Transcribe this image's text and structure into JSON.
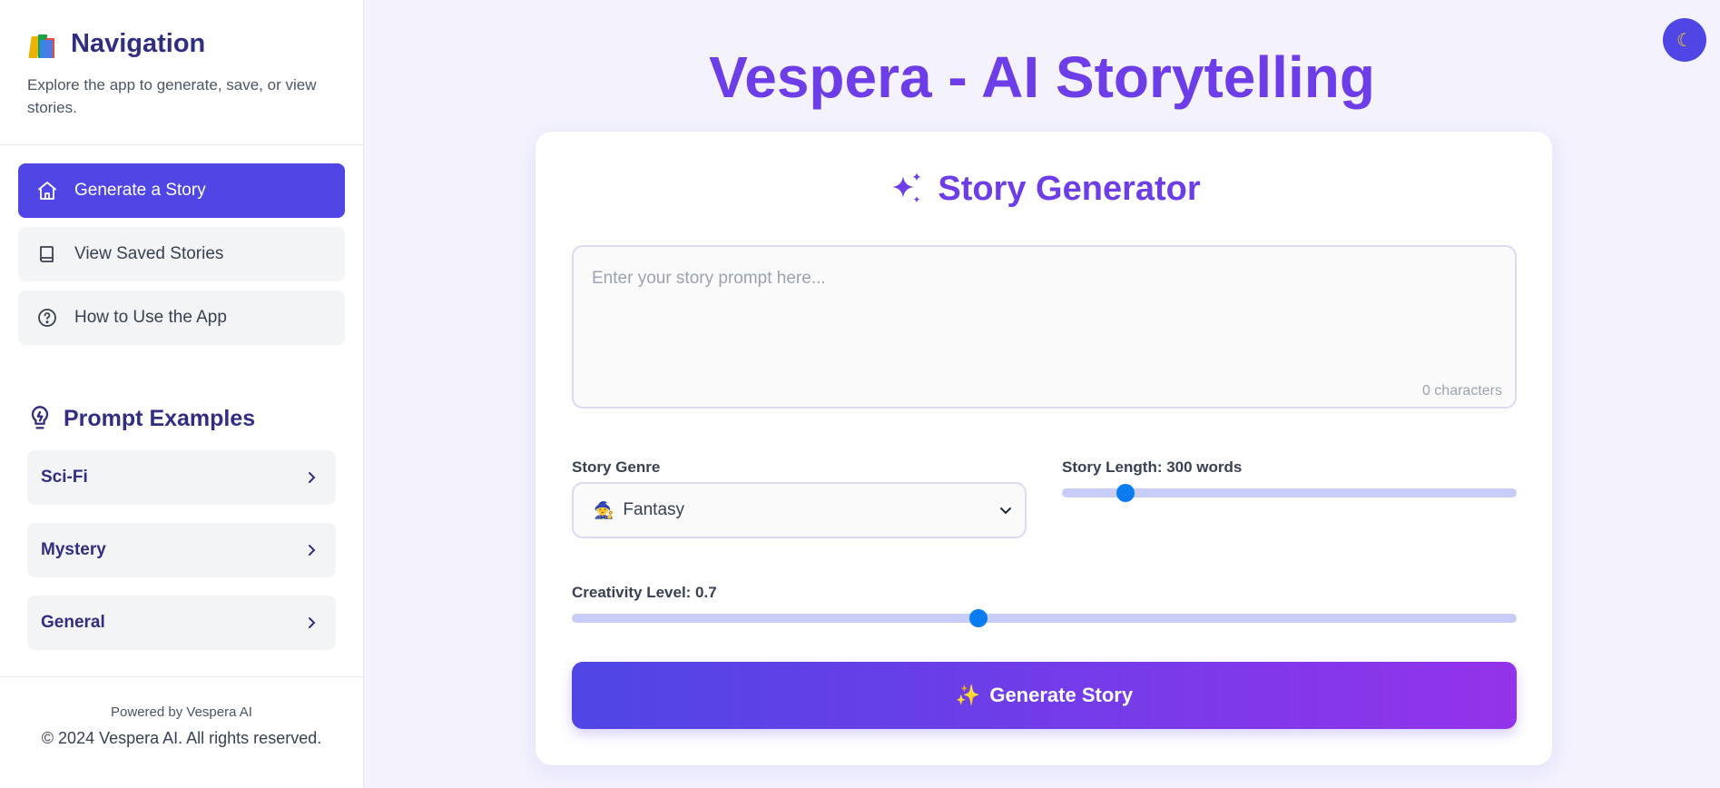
{
  "sidebar": {
    "title": "Navigation",
    "icon": "books-icon",
    "description": "Explore the app to generate, save, or view stories.",
    "menu": [
      {
        "label": "Generate a Story",
        "icon": "home-icon",
        "active": true
      },
      {
        "label": "View Saved Stories",
        "icon": "book-icon",
        "active": false
      },
      {
        "label": "How to Use the App",
        "icon": "help-circle-icon",
        "active": false
      }
    ],
    "prompt_examples_title": "Prompt Examples",
    "prompt_examples": [
      {
        "label": "Sci-Fi"
      },
      {
        "label": "Mystery"
      },
      {
        "label": "General"
      }
    ],
    "footer": {
      "powered_by": "Powered by Vespera AI",
      "copyright": "© 2024 Vespera AI. All rights reserved."
    }
  },
  "header": {
    "title": "Vespera - AI Storytelling",
    "theme_toggle_icon": "moon-icon"
  },
  "generator": {
    "title": "Story Generator",
    "title_icon": "sparkles-icon",
    "prompt_placeholder": "Enter your story prompt here...",
    "prompt_value": "",
    "char_count": "0 characters",
    "genre_label": "Story Genre",
    "genre_emoji": "🧙",
    "genre_selected": "Fantasy",
    "length_label": "Story Length: 300 words",
    "length_fraction": 0.14,
    "creativity_label": "Creativity Level: 0.7",
    "creativity_fraction": 0.43,
    "button_sparkle": "✨",
    "button_label": "Generate Story"
  },
  "colors": {
    "accent": "#4f46e5",
    "title_purple": "#6d3ee8",
    "slider_thumb": "#0a7cf0",
    "slider_track": "#c7cdf6"
  }
}
